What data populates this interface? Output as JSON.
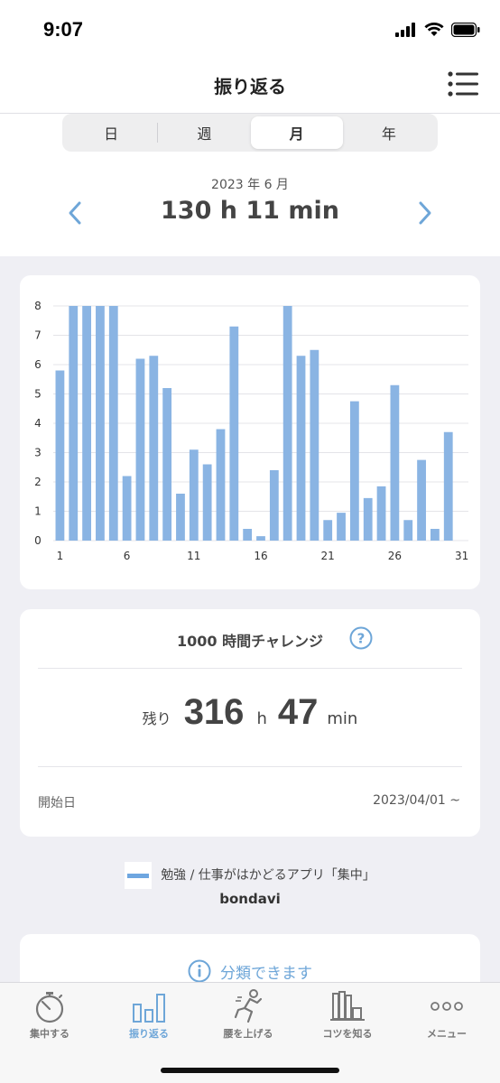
{
  "status": {
    "time": "9:07"
  },
  "nav": {
    "title": "振り返る"
  },
  "segments": [
    {
      "label": "日",
      "active": false
    },
    {
      "label": "週",
      "active": false
    },
    {
      "label": "月",
      "active": true
    },
    {
      "label": "年",
      "active": false
    }
  ],
  "period": {
    "label": "2023 年 6 月",
    "total": "130 h 11 min"
  },
  "chart_data": {
    "type": "bar",
    "x": [
      1,
      2,
      3,
      4,
      5,
      6,
      7,
      8,
      9,
      10,
      11,
      12,
      13,
      14,
      15,
      16,
      17,
      18,
      19,
      20,
      21,
      22,
      23,
      24,
      25,
      26,
      27,
      28,
      29,
      30,
      31
    ],
    "values": [
      5.8,
      8,
      8,
      8,
      8,
      2.2,
      6.2,
      6.3,
      5.2,
      1.6,
      3.1,
      2.6,
      3.8,
      7.3,
      0.4,
      0.15,
      2.4,
      8,
      6.3,
      6.5,
      0.7,
      0.95,
      4.75,
      1.45,
      1.85,
      5.3,
      0.7,
      2.75,
      0.4,
      3.7,
      0
    ],
    "xticks": [
      "1",
      "6",
      "11",
      "16",
      "21",
      "26",
      "31"
    ],
    "yticks": [
      "0",
      "1",
      "2",
      "3",
      "4",
      "5",
      "6",
      "7",
      "8"
    ],
    "ylim": [
      0,
      8
    ],
    "grid": true,
    "color": "#8ab4e3"
  },
  "challenge": {
    "title": "1000 時間チャレンジ",
    "remaining_label": "残り",
    "hours": "316",
    "hours_unit": "h",
    "minutes": "47",
    "minutes_unit": "min",
    "start_label": "開始日",
    "start_date": "2023/04/01 ~"
  },
  "footer": {
    "text": "勉強 / 仕事がはかどるアプリ「集中」",
    "brand": "bondavi"
  },
  "classify": {
    "label": "分類できます"
  },
  "tabs": [
    {
      "label": "集中する",
      "icon": "stopwatch-icon",
      "active": false
    },
    {
      "label": "振り返る",
      "icon": "bar-chart-icon",
      "active": true
    },
    {
      "label": "腰を上げる",
      "icon": "stretch-person-icon",
      "active": false
    },
    {
      "label": "コツを知る",
      "icon": "books-icon",
      "active": false
    },
    {
      "label": "メニュー",
      "icon": "more-dots-icon",
      "active": false
    }
  ],
  "colors": {
    "accent": "#6ea6d8",
    "bar": "#8ab4e3"
  }
}
